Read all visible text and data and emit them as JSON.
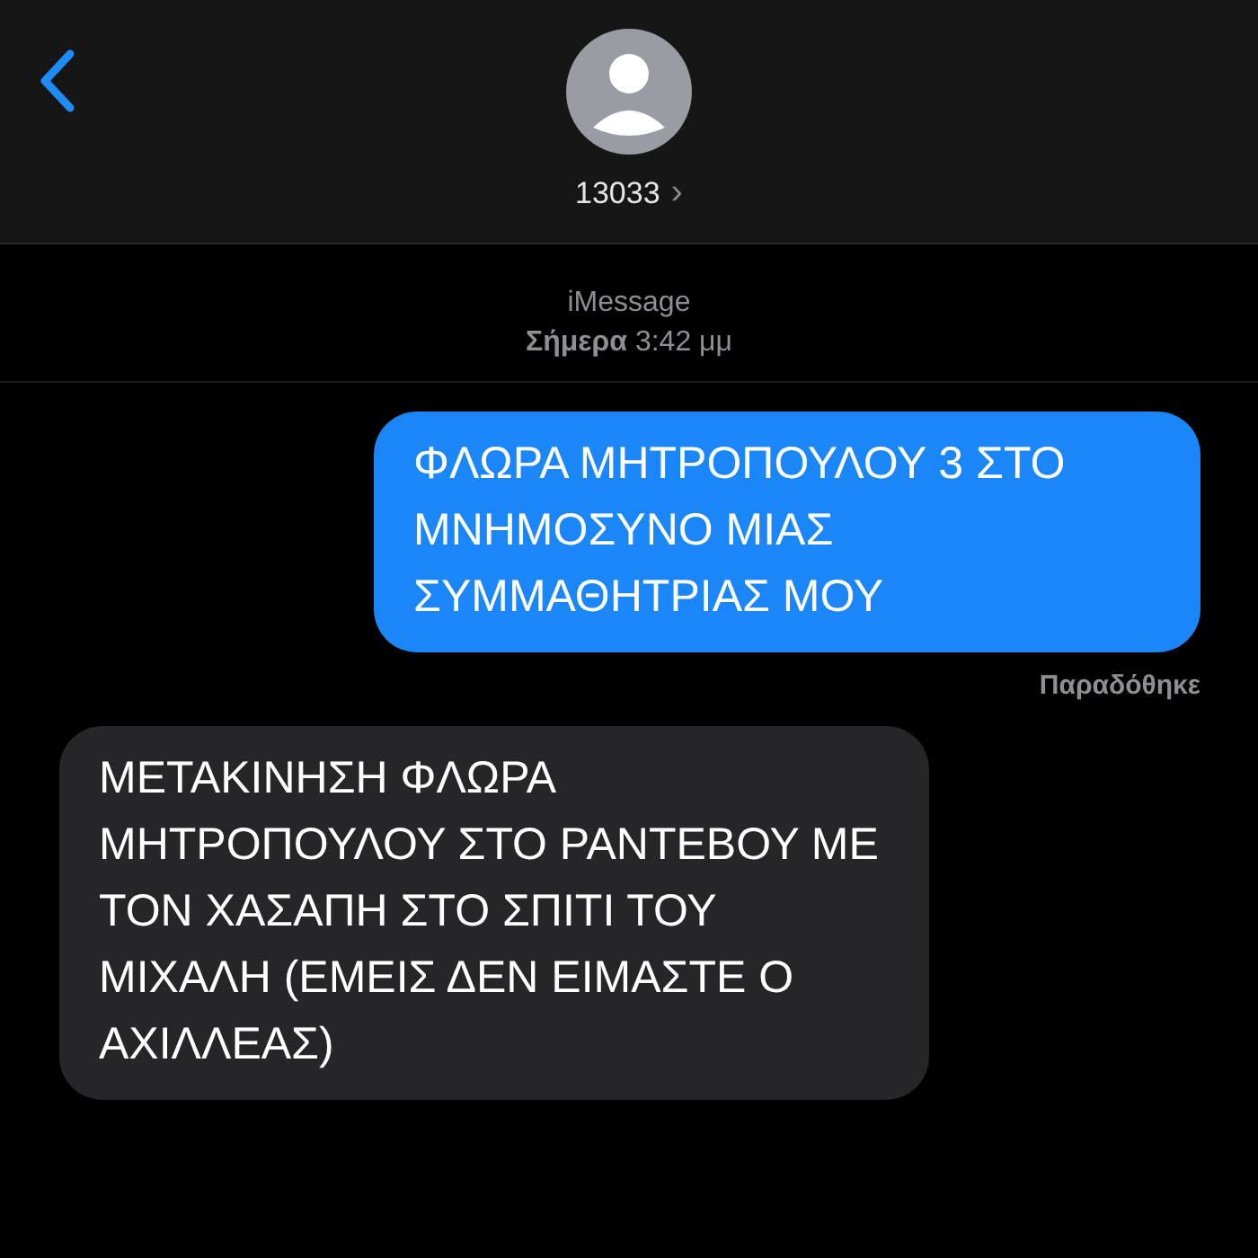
{
  "header": {
    "contact": "13033",
    "chevron": "›"
  },
  "service": {
    "name": "iMessage",
    "time": "**Σήμερα** 3:42 μμ"
  },
  "messages": [
    {
      "kind": "outgoing",
      "text": "ΦΛΩΡΑ ΜΗΤΡΟΠΟΥΛΟΥ 3 ΣΤΟ ΜΝΗΜΟΣΥΝΟ ΜΙΑΣ ΣΥΜΜΑΘΗΤΡΙΑΣ ΜΟΥ",
      "status": "Παραδόθηκε"
    },
    {
      "kind": "incoming",
      "text": "ΜΕΤΑΚΙΝΗΣΗ ΦΛΩΡΑ ΜΗΤΡΟΠΟΥΛΟΥ ΣΤΟ ΡΑΝΤΕΒΟΥ ΜΕ ΤΟΝ ΧΑΣΑΠΗ ΣΤΟ ΣΠΙΤΙ ΤΟΥ ΜΙΧΑΛΗ (ΕΜΕΙΣ ΔΕΝ ΕΙΜΑΣΤΕ Ο ΑΧΙΛΛΕΑΣ)"
    }
  ]
}
